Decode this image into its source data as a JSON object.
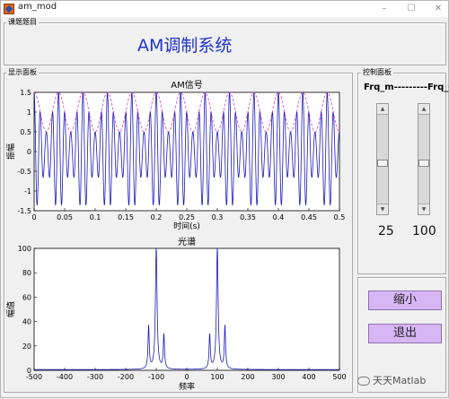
{
  "window": {
    "title": "am_mod"
  },
  "panels": {
    "title_panel": "课题题目",
    "display_panel": "显示面板",
    "control_panel": "控制面板"
  },
  "main_title": "AM调制系统",
  "controls": {
    "frq_label": "Frq_m---------Frq_c",
    "frq_m_value": "25",
    "frq_c_value": "100",
    "shrink_label": "缩小",
    "exit_label": "退出"
  },
  "watermark": "天天Matlab",
  "colors": {
    "accent_title": "#1f34c8",
    "button_bg": "#d6b6f4",
    "signal": "#1a1ab8",
    "envelope": "#d040c0"
  },
  "chart_data": [
    {
      "type": "line",
      "title": "AM信号",
      "xlabel": "时间(s)",
      "ylabel": "振幅",
      "xlim": [
        0,
        0.5
      ],
      "ylim": [
        -1.5,
        1.5
      ],
      "xticks": [
        "0",
        "0.05",
        "0.1",
        "0.15",
        "0.2",
        "0.25",
        "0.3",
        "0.35",
        "0.4",
        "0.45",
        "0.5"
      ],
      "yticks": [
        "-1.5",
        "-1",
        "-0.5",
        "0",
        "0.5",
        "1",
        "1.5"
      ],
      "series": [
        {
          "formula": "(1 + 0.5*cos(2*pi*25*t)) * cos(2*pi*100*t)",
          "color": "#1a1ab8"
        },
        {
          "formula": "1 + 0.5*cos(2*pi*25*t)",
          "color": "#d040c0",
          "style": "dashed"
        }
      ],
      "modulation_index": 0.5,
      "f_m": 25,
      "f_c": 100
    },
    {
      "type": "line",
      "title": "光谱",
      "xlabel": "频率",
      "ylabel": "幅值",
      "xlim": [
        -500,
        500
      ],
      "ylim": [
        0,
        100
      ],
      "xticks": [
        "-500",
        "-400",
        "-300",
        "-200",
        "-100",
        "0",
        "100",
        "200",
        "300",
        "400",
        "500"
      ],
      "yticks": [
        "0",
        "20",
        "40",
        "60",
        "80",
        "100"
      ],
      "peaks": [
        {
          "x": -125,
          "y": 35
        },
        {
          "x": -100,
          "y": 100
        },
        {
          "x": -75,
          "y": 28
        },
        {
          "x": 75,
          "y": 28
        },
        {
          "x": 100,
          "y": 100
        },
        {
          "x": 125,
          "y": 35
        }
      ],
      "color": "#1a1ab8"
    }
  ]
}
